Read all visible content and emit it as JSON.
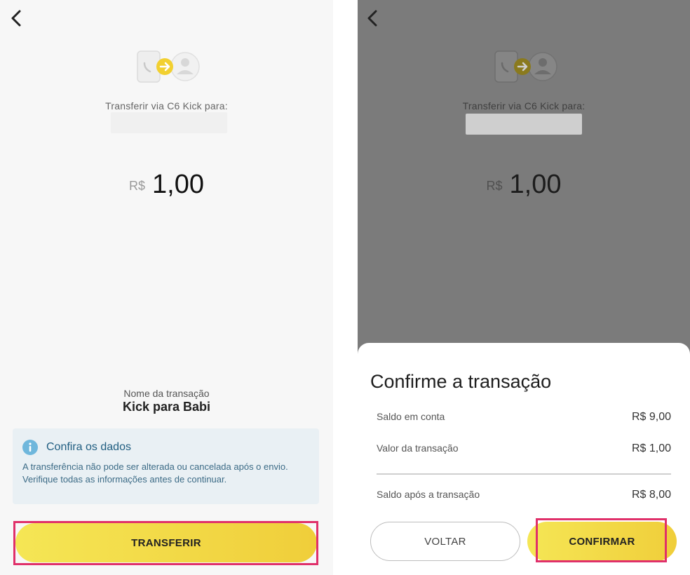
{
  "left_screen": {
    "caption": "Transferir via C6 Kick para:",
    "amount_currency": "R$",
    "amount_value": "1,00",
    "transaction_name_label": "Nome da transação",
    "transaction_name": "Kick para Babi",
    "notice": {
      "title": "Confira os dados",
      "text": "A transferência não pode ser alterada ou cancelada após o envio. Verifique todas as informações antes de continuar.",
      "icon": "info-icon"
    },
    "primary_button": "TRANSFERIR"
  },
  "right_screen": {
    "caption": "Transferir via C6 Kick para:",
    "amount_currency": "R$",
    "amount_value": "1,00",
    "sheet": {
      "title": "Confirme a transação",
      "rows": [
        {
          "label": "Saldo em conta",
          "value": "R$ 9,00"
        },
        {
          "label": "Valor da transação",
          "value": "R$ 1,00"
        },
        {
          "label": "Saldo após a transação",
          "value": "R$ 8,00"
        }
      ],
      "secondary_button": "VOLTAR",
      "primary_button": "CONFIRMAR"
    }
  },
  "colors": {
    "accent_yellow": "#f2d63f",
    "highlight": "#e0306a",
    "info_blue": "#1f5d80"
  }
}
